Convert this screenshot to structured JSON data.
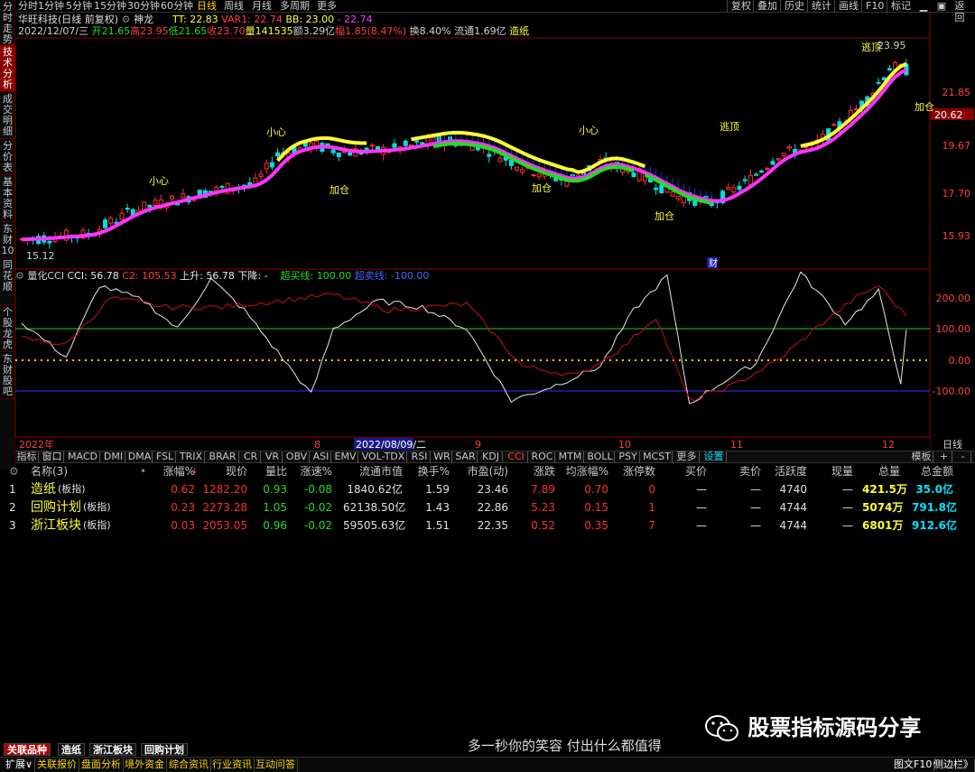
{
  "topbar": {
    "timeframes": [
      "分时",
      "1分钟",
      "5分钟",
      "15分钟",
      "30分钟",
      "60分钟",
      "日线",
      "周线",
      "月线",
      "多周期",
      "更多"
    ],
    "active_timeframe": "日线",
    "actions": [
      "复权",
      "叠加",
      "历史",
      "统计",
      "画线",
      "F10",
      "标记"
    ]
  },
  "left_tabs": [
    "分时走势",
    "技术分析",
    "成交明细",
    "分价表",
    "基本资料",
    "东财10",
    "同花顺",
    "个股龙虎",
    "东财股吧"
  ],
  "stock": {
    "name": "华旺科技",
    "mode": "(日线 前复权)",
    "indicator": "神龙",
    "tt_label": "TT: 22.83",
    "var1_label": "VAR1: 22.74",
    "bb_label": "BB: 23.00",
    "dash_label": "- 22.74"
  },
  "quote": {
    "date": "2022/12/07/三",
    "open": "开21.65",
    "high": "高23.95",
    "low": "低21.65",
    "close": "收23.70",
    "volume": "量141535",
    "amount": "额3.29亿",
    "change": "幅1.85(8.47%)",
    "turnover": "换8.40%",
    "float": "流通1.69亿",
    "sector": "造纸"
  },
  "price_axis": [
    "21.85",
    "19.67",
    "17.70",
    "15.93"
  ],
  "current_price": "20.62",
  "chart_annotations": {
    "add": "加仓",
    "careful": "小心",
    "escape": "逃顶",
    "low_label": "15.12",
    "fin": "财",
    "top_tag": "23.95"
  },
  "indicator_bar": {
    "name": "量化CCI",
    "cci": "CCI: 56.78",
    "c2": "C2: 105.53",
    "up": "上升: 56.78",
    "down": "下降: -",
    "overbought": "超买线: 100.00",
    "oversold": "超卖线: -100.00"
  },
  "cci_axis": [
    "200.00",
    "100.00",
    "0.00",
    "-100.00"
  ],
  "time_axis": {
    "year": "2022年",
    "months": [
      "8",
      "9",
      "10",
      "11",
      "12"
    ],
    "cursor_date": "2022/08/09/二",
    "period": "日线"
  },
  "indicator_tabs": [
    "指标",
    "窗口",
    "MACD",
    "DMI",
    "DMA",
    "FSL",
    "TRIX",
    "BRAR",
    "CR",
    "VR",
    "OBV",
    "ASI",
    "EMV",
    "VOL-TDX",
    "RSI",
    "WR",
    "SAR",
    "KDJ",
    "CCI",
    "ROC",
    "MTM",
    "BOLL",
    "PSY",
    "MCST",
    "更多",
    "设置"
  ],
  "template_label": "模板",
  "table": {
    "headers": [
      "名称(3)",
      "涨幅%",
      "现价",
      "量比",
      "涨速%",
      "流通市值",
      "换手%",
      "市盈(动)",
      "涨跌",
      "均涨幅%",
      "涨停数",
      "买价",
      "卖价",
      "活跃度",
      "现量",
      "总量",
      "总金额"
    ],
    "rows": [
      {
        "idx": "1",
        "name": "造纸",
        "tag": "(板指)",
        "chg": "0.62",
        "price": "1282.20",
        "vr": "0.93",
        "speed": "-0.08",
        "mcap": "1840.62亿",
        "turn": "1.59",
        "pe": "23.46",
        "diff": "7.89",
        "avg": "0.70",
        "limit": "0",
        "bid": "—",
        "ask": "—",
        "active": "4740",
        "cur": "—",
        "vol": "421.5万",
        "amt": "35.0亿"
      },
      {
        "idx": "2",
        "name": "回购计划",
        "tag": "(板指)",
        "chg": "0.23",
        "price": "2273.28",
        "vr": "1.05",
        "speed": "-0.02",
        "mcap": "62138.50亿",
        "turn": "1.43",
        "pe": "22.86",
        "diff": "5.23",
        "avg": "0.15",
        "limit": "1",
        "bid": "—",
        "ask": "—",
        "active": "4744",
        "cur": "—",
        "vol": "5074万",
        "amt": "791.8亿"
      },
      {
        "idx": "3",
        "name": "浙江板块",
        "tag": "(板指)",
        "chg": "0.03",
        "price": "2053.05",
        "vr": "0.96",
        "speed": "-0.02",
        "mcap": "59505.63亿",
        "turn": "1.51",
        "pe": "22.35",
        "diff": "0.52",
        "avg": "0.35",
        "limit": "7",
        "bid": "—",
        "ask": "—",
        "active": "4744",
        "cur": "—",
        "vol": "6801万",
        "amt": "912.6亿"
      }
    ]
  },
  "bottom_tabs": [
    "关联品种",
    "造纸",
    "浙江板块",
    "回购计划"
  ],
  "status_tabs": [
    "扩展∨",
    "关联报价",
    "盘面分析",
    "境外资金",
    "综合资讯",
    "行业资讯",
    "互动问答"
  ],
  "status_right": [
    "图文F10",
    "侧边栏》"
  ],
  "watermark": "股票指标源码分享",
  "slogan": "多一秒你的笑容 付出什么都值得",
  "colors": {
    "up": "#ff3030",
    "down": "#00e0e0",
    "magenta": "#ff33ff",
    "yellow": "#ffff33",
    "green": "#22dd22",
    "blue": "#3333ff"
  }
}
